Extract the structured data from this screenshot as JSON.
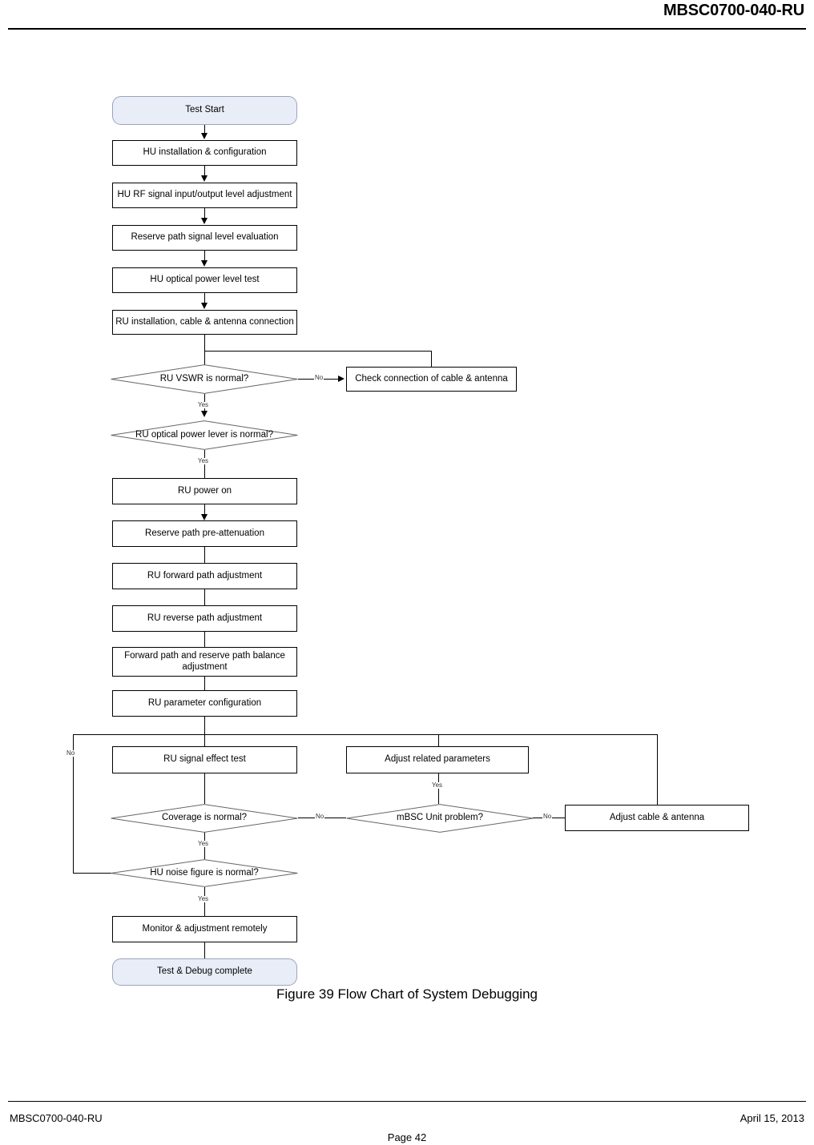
{
  "header": {
    "title": "MBSC0700-040-RU"
  },
  "footer": {
    "left": "MBSC0700-040-RU",
    "right": "April 15, 2013",
    "page": "Page 42"
  },
  "figure": {
    "caption": "Figure 39 Flow Chart of System Debugging"
  },
  "flowchart": {
    "nodes": [
      {
        "id": "test-start",
        "type": "terminator",
        "label": "Test Start"
      },
      {
        "id": "hu-install",
        "type": "process",
        "label": "HU installation & configuration"
      },
      {
        "id": "hu-rf-level",
        "type": "process",
        "label": "HU RF signal input/output level adjustment"
      },
      {
        "id": "reserve-path-eval",
        "type": "process",
        "label": "Reserve path signal level evaluation"
      },
      {
        "id": "hu-optical-test",
        "type": "process",
        "label": "HU optical power level test"
      },
      {
        "id": "ru-install",
        "type": "process",
        "label": "RU installation, cable & antenna connection"
      },
      {
        "id": "ru-vswr-normal",
        "type": "decision",
        "label": "RU VSWR is normal?"
      },
      {
        "id": "check-connection",
        "type": "process",
        "label": "Check connection of cable & antenna"
      },
      {
        "id": "ru-optical-normal",
        "type": "decision",
        "label": "RU optical power lever is normal?"
      },
      {
        "id": "ru-power-on",
        "type": "process",
        "label": "RU power on"
      },
      {
        "id": "reserve-pre-atten",
        "type": "process",
        "label": "Reserve path pre-attenuation"
      },
      {
        "id": "ru-forward-adjust",
        "type": "process",
        "label": "RU forward path adjustment"
      },
      {
        "id": "ru-reverse-adjust",
        "type": "process",
        "label": "RU reverse path adjustment"
      },
      {
        "id": "fwd-rev-balance",
        "type": "process",
        "label": "Forward path and reserve path balance adjustment"
      },
      {
        "id": "ru-param-config",
        "type": "process",
        "label": "RU parameter configuration"
      },
      {
        "id": "ru-signal-effect",
        "type": "process",
        "label": "RU signal effect test"
      },
      {
        "id": "adjust-related-params",
        "type": "process",
        "label": "Adjust related parameters"
      },
      {
        "id": "coverage-normal",
        "type": "decision",
        "label": "Coverage is normal?"
      },
      {
        "id": "mbsc-unit-problem",
        "type": "decision",
        "label": "mBSC Unit problem?"
      },
      {
        "id": "adjust-cable-antenna",
        "type": "process",
        "label": "Adjust cable & antenna"
      },
      {
        "id": "hu-noise-normal",
        "type": "decision",
        "label": "HU noise figure is normal?"
      },
      {
        "id": "monitor-remote",
        "type": "process",
        "label": "Monitor & adjustment remotely"
      },
      {
        "id": "test-complete",
        "type": "terminator",
        "label": "Test & Debug complete"
      }
    ],
    "edge_labels": {
      "vswr_no": "No",
      "vswr_yes": "Yes",
      "optical_yes": "Yes",
      "coverage_no": "No",
      "coverage_yes": "Yes",
      "mbsc_no": "No",
      "mbsc_yes": "Yes",
      "noise_no": "No",
      "noise_yes": "Yes"
    },
    "colors": {
      "terminator_fill": "#e8edf7",
      "terminator_stroke": "#9aa4bb",
      "process_stroke": "#000000",
      "decision_stroke": "#666666",
      "connector": "#000000"
    }
  }
}
